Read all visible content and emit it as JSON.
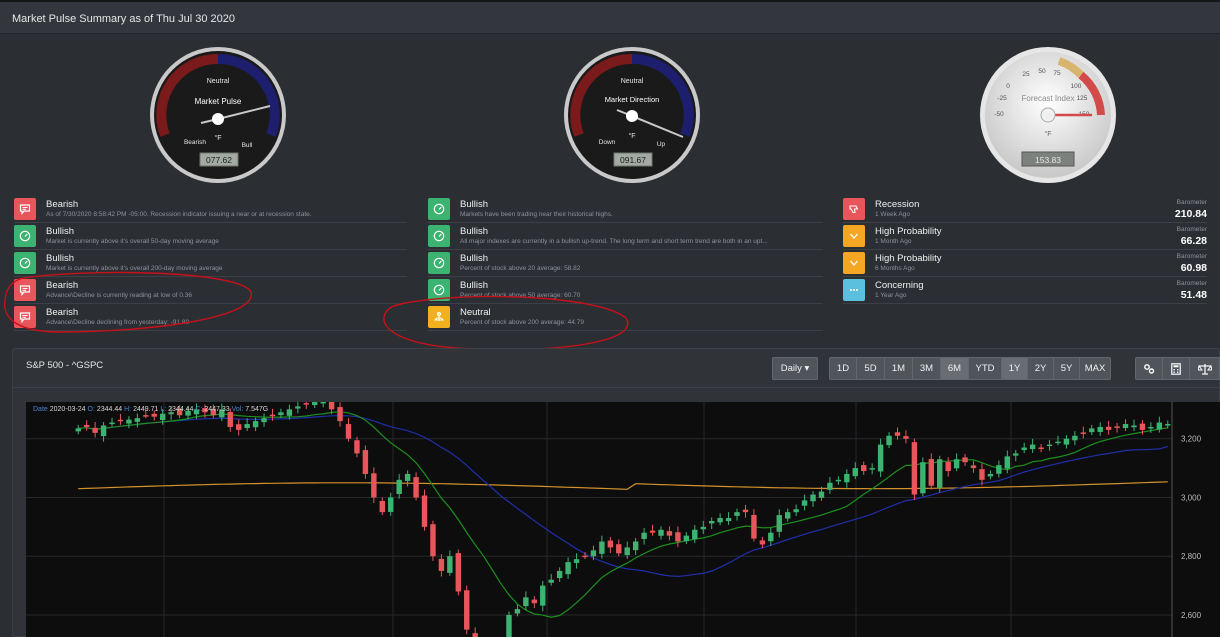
{
  "header": {
    "title": "Market Pulse Summary as of Thu Jul 30 2020"
  },
  "gauges": {
    "pulse": {
      "title": "Market Pulse",
      "top_label": "Neutral",
      "left_label": "Bearish",
      "right_label": "Bull",
      "unit": "°F",
      "value": "077.62"
    },
    "direction": {
      "title": "Market Direction",
      "top_label": "Neutral",
      "left_label": "Down",
      "right_label": "Up",
      "unit": "°F",
      "value": "091.67"
    },
    "forecast": {
      "title": "Forecast Index",
      "unit": "°F",
      "value": "153.83",
      "ticks": [
        "-50",
        "-25",
        "0",
        "25",
        "50",
        "75",
        "100",
        "125",
        "150"
      ]
    }
  },
  "columns": {
    "left": [
      {
        "status": "Bearish",
        "icon": "speech-bubble-icon",
        "color": "#e8555a",
        "desc": "As of 7/30/2020 8:58:42 PM -05:00. Recession indicator issuing a near or at recession state."
      },
      {
        "status": "Bullish",
        "icon": "gauge-icon",
        "color": "#3cb371",
        "desc": "Market is currently above it's overall 50-day moving average"
      },
      {
        "status": "Bullish",
        "icon": "gauge-icon",
        "color": "#3cb371",
        "desc": "Market is currently above it's overall 200-day moving average"
      },
      {
        "status": "Bearish",
        "icon": "speech-bubble-icon",
        "color": "#e8555a",
        "desc": "Advance\\Decline is currently reading at low of 0.36"
      },
      {
        "status": "Bearish",
        "icon": "speech-bubble-icon",
        "color": "#e8555a",
        "desc": "Advance\\Decline declining from yesterday: -91.80"
      }
    ],
    "middle": [
      {
        "status": "Bullish",
        "icon": "gauge-icon",
        "color": "#3cb371",
        "desc": "Markets have been trading near their historical highs."
      },
      {
        "status": "Bullish",
        "icon": "gauge-icon",
        "color": "#3cb371",
        "desc": "All major indexes are currently in a bullish up-trend. The long term and short term trend are both in an upt..."
      },
      {
        "status": "Bullish",
        "icon": "gauge-icon",
        "color": "#3cb371",
        "desc": "Percent of stock above 20 average: 58.82"
      },
      {
        "status": "Bullish",
        "icon": "gauge-icon",
        "color": "#3cb371",
        "desc": "Percent of stock above 50 average: 60.70"
      },
      {
        "status": "Neutral",
        "icon": "balance-icon",
        "color": "#f2b01e",
        "desc": "Percent of stock above 200 average: 44.79"
      }
    ],
    "right": [
      {
        "status": "Recession",
        "icon": "thumbs-down-icon",
        "color": "#e8555a",
        "desc": "1 Week Ago",
        "bar_label": "Barometer",
        "bar_value": "210.84"
      },
      {
        "status": "High Probability",
        "icon": "chevron-down-icon",
        "color": "#f5a623",
        "desc": "1 Month Ago",
        "bar_label": "Barometer",
        "bar_value": "66.28"
      },
      {
        "status": "High Probability",
        "icon": "chevron-down-icon",
        "color": "#f5a623",
        "desc": "6 Months Ago",
        "bar_label": "Barometer",
        "bar_value": "60.98"
      },
      {
        "status": "Concerning",
        "icon": "ellipsis-icon",
        "color": "#5bc0de",
        "desc": "1 Year Ago",
        "bar_label": "Barometer",
        "bar_value": "51.48"
      }
    ]
  },
  "chart_panel": {
    "title": "S&P 500 - ^GSPC",
    "interval": "Daily ▾",
    "ranges": [
      "1D",
      "5D",
      "1M",
      "3M",
      "6M",
      "YTD",
      "1Y",
      "2Y",
      "5Y",
      "MAX"
    ],
    "active_ranges": [
      "6M",
      "1Y"
    ],
    "tool_icons": [
      "settings-icon",
      "calculator-icon",
      "balance-icon"
    ],
    "ohlc": {
      "date_k": "Date",
      "date": "2020-03-24",
      "o_k": "O:",
      "o": "2344.44",
      "h_k": "H:",
      "h": "2449.71",
      "l_k": "L:",
      "l": "2344.44",
      "c_k": "C:",
      "c": "2447.33",
      "v_k": "Vol:",
      "v": "7.547G"
    }
  },
  "chart_data": {
    "type": "candlestick",
    "y_ticks": [
      "3,200",
      "3,000",
      "2,800",
      "2,600"
    ],
    "y_tick_values": [
      3200,
      3000,
      2800,
      2600
    ],
    "ylim": [
      2525,
      3325
    ],
    "candle_colors": {
      "up": "#3cb371",
      "down": "#e8555a"
    },
    "ma_colors": {
      "short": "#1d8f1d",
      "medium": "#1f2fa8",
      "long": "#d4912a"
    },
    "closes": [
      3235,
      3240,
      3220,
      3245,
      3255,
      3260,
      3265,
      3270,
      3280,
      3275,
      3285,
      3290,
      3280,
      3295,
      3300,
      3290,
      3280,
      3300,
      3240,
      3230,
      3250,
      3260,
      3270,
      3280,
      3290,
      3300,
      3310,
      3320,
      3330,
      3335,
      3300,
      3260,
      3200,
      3150,
      3080,
      3000,
      2950,
      3000,
      3060,
      3080,
      3000,
      2900,
      2800,
      2750,
      2800,
      2680,
      2550,
      2500,
      2480,
      2460,
      2500,
      2600,
      2620,
      2660,
      2640,
      2700,
      2720,
      2750,
      2780,
      2790,
      2800,
      2820,
      2850,
      2830,
      2810,
      2830,
      2850,
      2880,
      2880,
      2890,
      2870,
      2850,
      2870,
      2890,
      2900,
      2920,
      2930,
      2930,
      2950,
      2950,
      2860,
      2840,
      2880,
      2940,
      2950,
      2960,
      2990,
      3010,
      3020,
      3050,
      3060,
      3080,
      3100,
      3090,
      3100,
      3180,
      3210,
      3210,
      3200,
      3010,
      3120,
      3040,
      3130,
      3090,
      3130,
      3120,
      3100,
      3060,
      3080,
      3110,
      3140,
      3150,
      3170,
      3180,
      3170,
      3180,
      3190,
      3200,
      3210,
      3220,
      3235,
      3240,
      3230,
      3240,
      3250,
      3245,
      3230,
      3240,
      3255,
      3250
    ]
  }
}
